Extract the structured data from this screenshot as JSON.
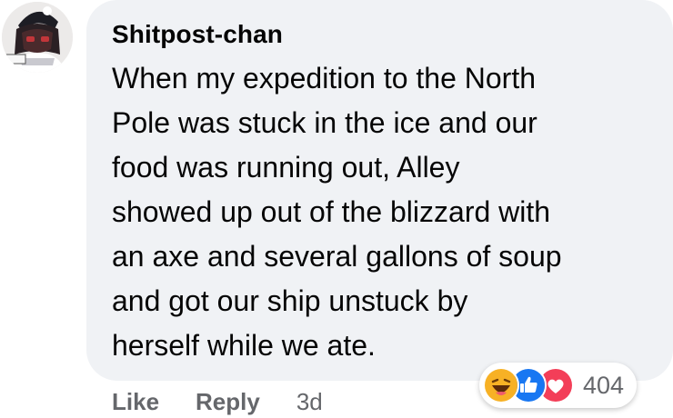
{
  "comment": {
    "author": "Shitpost-chan",
    "text": "When my expedition to the North\nPole was stuck in the ice and our\nfood was running out, Alley\nshowed up out of the blizzard with\nan axe and several gallons of soup\nand got our ship unstuck by\nherself while we ate.",
    "avatar_icon": "anime-character-avatar-icon"
  },
  "actions": {
    "like_label": "Like",
    "reply_label": "Reply",
    "timestamp": "3d"
  },
  "reactions": {
    "icons": [
      "haha-icon",
      "like-icon",
      "love-icon"
    ],
    "count": "404",
    "colors": {
      "haha": "#f7b125",
      "like": "#1877f2",
      "love": "#f33e58"
    }
  }
}
